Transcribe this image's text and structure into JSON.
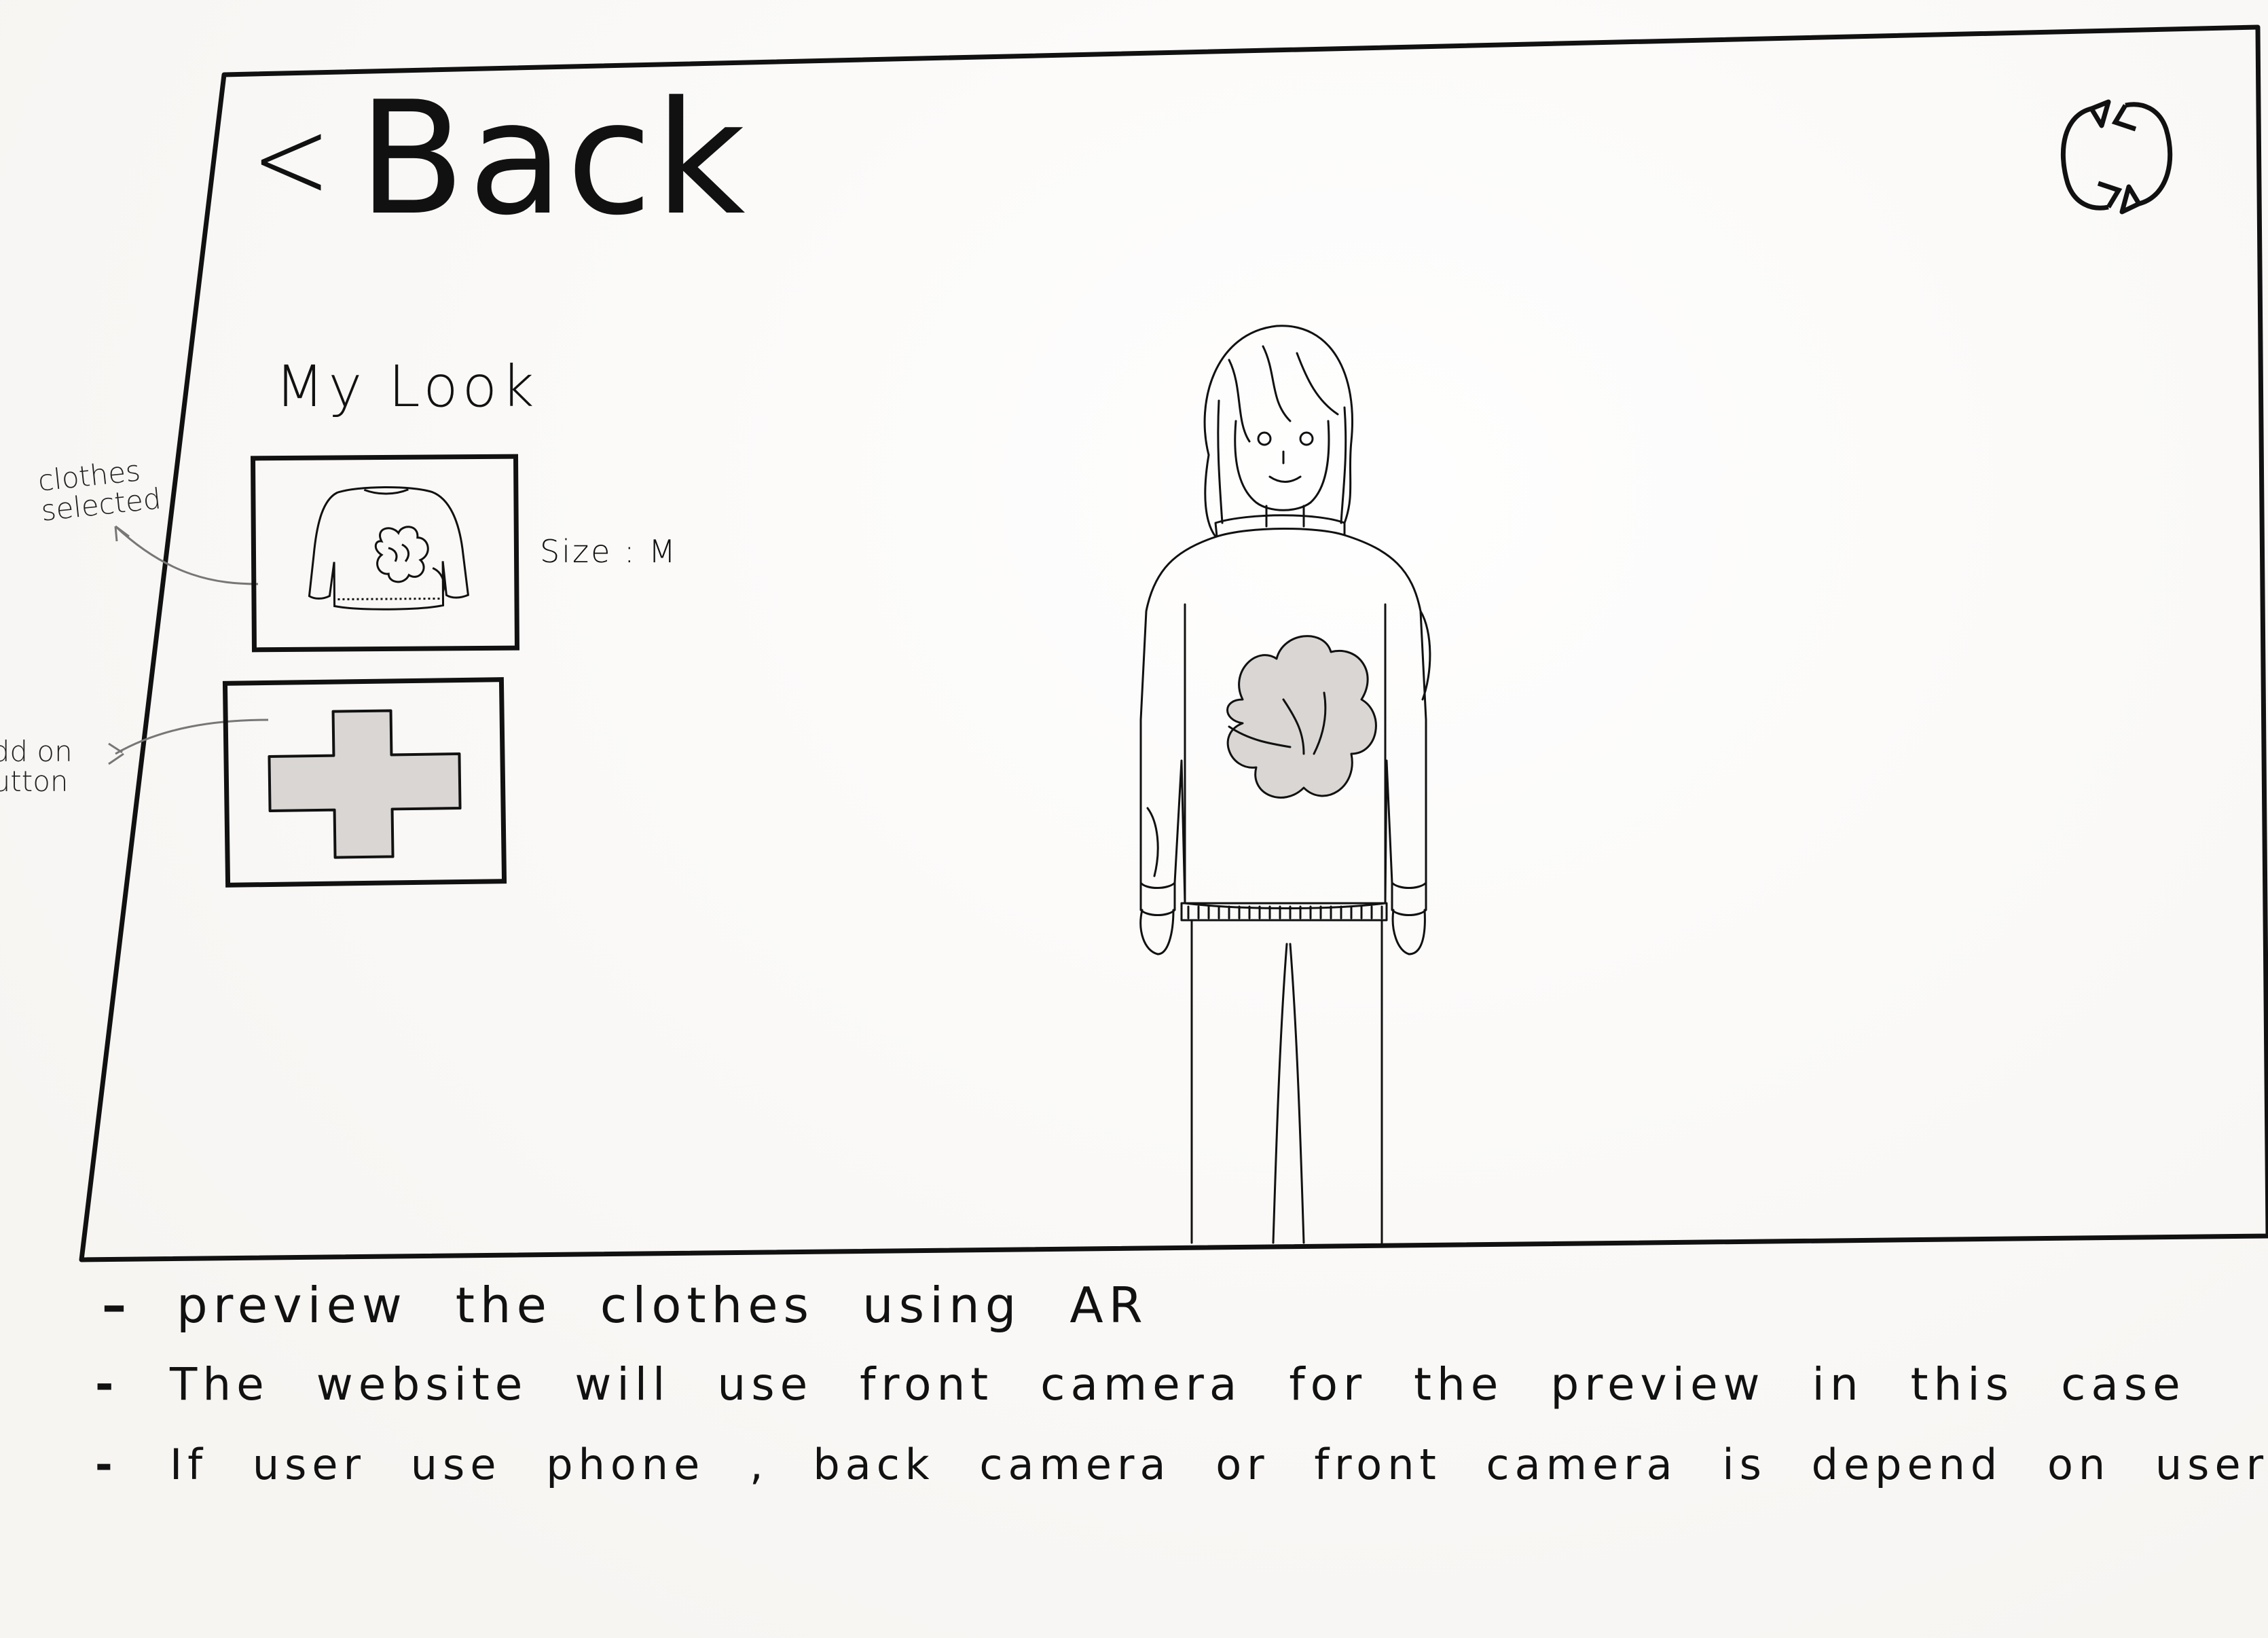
{
  "header": {
    "back_chevron": "<",
    "back_label": "Back",
    "refresh_icon": "refresh-icon"
  },
  "my_look": {
    "title": "My Look",
    "selected_item": {
      "icon": "sweater-icon",
      "size_label": "Size : M"
    },
    "add_button": {
      "icon": "plus-icon"
    }
  },
  "annotations": {
    "selected": "clothes selected",
    "add": "add on button"
  },
  "preview": {
    "figure": "person-wearing-sweater"
  },
  "notes": [
    "preview the clothes using AR",
    "The website will use front camera for the preview in this case",
    "If user use phone , back camera or front camera is depend on user"
  ],
  "colors": {
    "ink": "#111111",
    "paper": "#faf8f6",
    "fill_grey": "#d9d6d4"
  }
}
